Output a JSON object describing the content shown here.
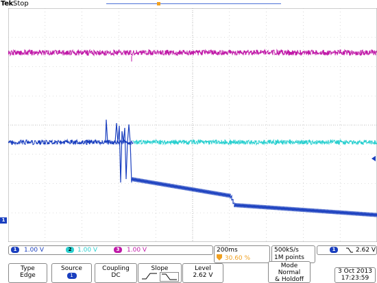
{
  "header": {
    "brand": "Tek",
    "status": "Stop"
  },
  "markers": {
    "trigger_position_glyph": "T",
    "ch1_glyph": "1"
  },
  "channels": [
    {
      "id": "1",
      "scale": "1.00 V",
      "color": "#1a3fbf"
    },
    {
      "id": "2",
      "scale": "1.00 V",
      "color": "#2bd0d0"
    },
    {
      "id": "3",
      "scale": "1.00 V",
      "color": "#c01aa8"
    }
  ],
  "timebase": {
    "scale": "200ms",
    "trigger_pos_icon": "trigger-position-icon",
    "position": "30.60 %"
  },
  "acquisition": {
    "rate": "500kS/s",
    "record": "1M points"
  },
  "trigger_readout": {
    "source": "1",
    "slope_icon": "falling-edge-icon",
    "level": "2.62 V"
  },
  "menu": {
    "type": {
      "label": "Type",
      "value": "Edge"
    },
    "source": {
      "label": "Source",
      "value": "1"
    },
    "coupling": {
      "label": "Coupling",
      "value": "DC"
    },
    "slope": {
      "label": "Slope"
    },
    "level": {
      "label": "Level",
      "value": "2.62 V"
    },
    "mode": {
      "label": "Mode",
      "value1": "Normal",
      "value2": "& Holdoff"
    }
  },
  "datetime": {
    "date": "3 Oct  2013",
    "time": "17:23:59"
  },
  "colors": {
    "ch1": "#1a3fbf",
    "ch2": "#2bd0d0",
    "ch3": "#c01aa8",
    "accent": "#f0a020"
  }
}
